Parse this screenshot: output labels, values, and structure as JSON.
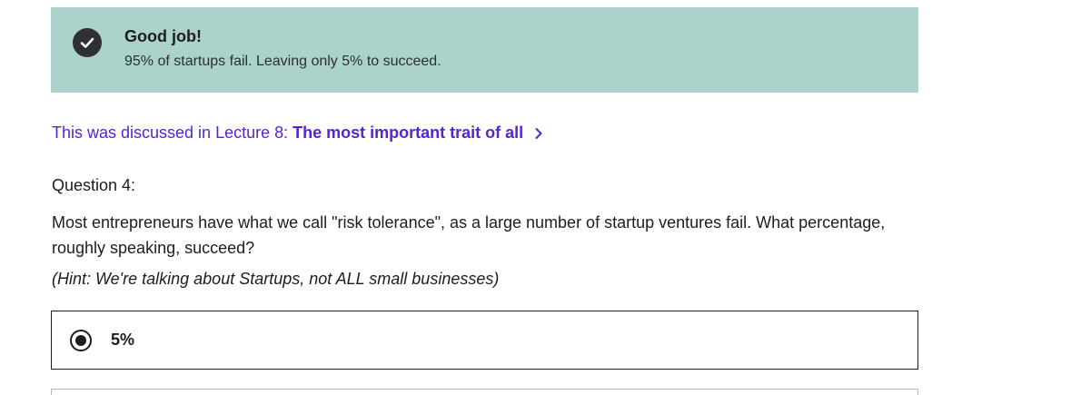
{
  "feedback": {
    "title": "Good job!",
    "message": "95% of startups fail. Leaving only 5% to succeed.",
    "icon": "check-circle-icon",
    "background_color": "#acd2cc"
  },
  "lecture_link": {
    "prefix": "This was discussed in Lecture 8:",
    "title": "The most important trait of all",
    "icon": "chevron-right-icon",
    "color": "#5624d0"
  },
  "question": {
    "number_label": "Question 4:",
    "text": "Most entrepreneurs have what we call \"risk tolerance\", as a large number of startup ventures fail. What percentage, roughly speaking, succeed?",
    "hint": "(Hint: We're talking about Startups, not ALL small businesses)"
  },
  "answers": [
    {
      "label": "5%",
      "selected": true
    }
  ]
}
